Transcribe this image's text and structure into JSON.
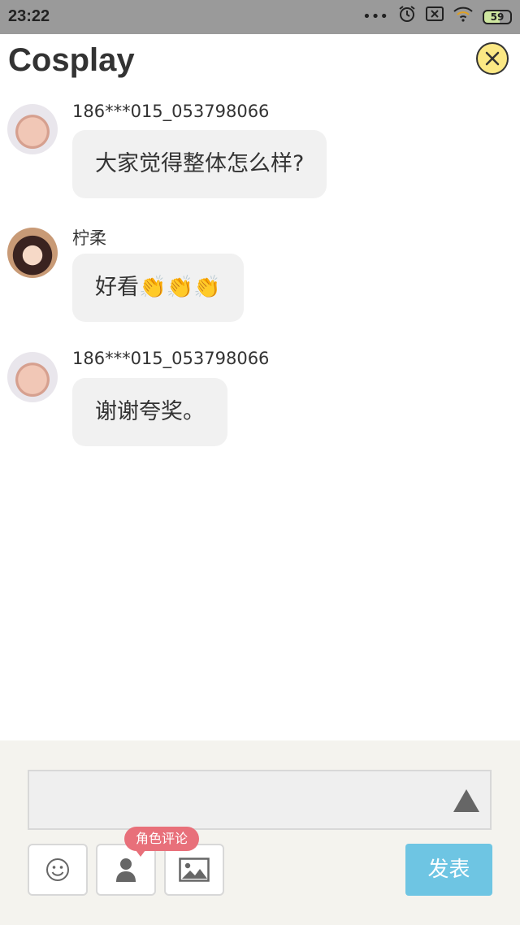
{
  "status_bar": {
    "time": "23:22",
    "more": "•••",
    "alarm_icon": "alarm-icon",
    "no_sim_icon": "no-sim-icon",
    "wifi_icon": "wifi-icon",
    "battery": "59"
  },
  "header": {
    "title": "Cosplay",
    "close_icon": "close-icon"
  },
  "messages": [
    {
      "sender": "186***015_053798066",
      "text": "大家觉得整体怎么样?"
    },
    {
      "sender": "柠柔",
      "text": "好看👏👏👏"
    },
    {
      "sender": "186***015_053798066",
      "text": "谢谢夸奖。"
    }
  ],
  "composer": {
    "input_value": "",
    "tools": [
      "emoji-icon",
      "person-icon",
      "image-icon"
    ],
    "role_comment_tag": "角色评论",
    "publish_label": "发表"
  },
  "colors": {
    "status_bar": "#9a9a9a",
    "bubble": "#f1f1f1",
    "close_button": "#fbe884",
    "tag": "#e8707a",
    "publish": "#6ec5e3",
    "panel": "#f4f3ee"
  }
}
